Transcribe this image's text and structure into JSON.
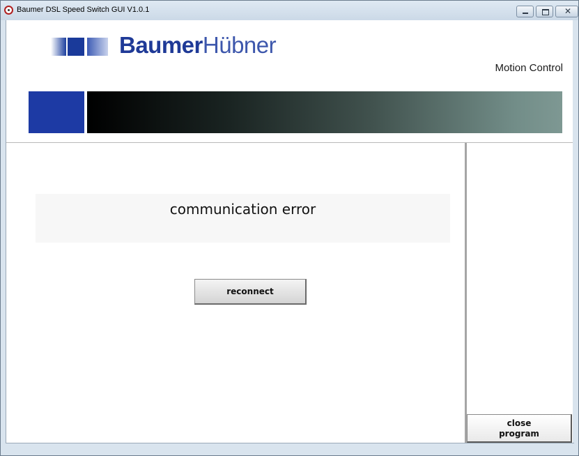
{
  "window": {
    "title": "Baumer DSL Speed Switch GUI V1.0.1",
    "controls": {
      "minimize": "minimize-icon",
      "maximize": "maximize-icon",
      "close": "close-icon",
      "close_glyph": "✕"
    }
  },
  "header": {
    "logo": {
      "brand_bold": "Baumer",
      "brand_light": "Hübner",
      "brand_color": "#1f3a97"
    },
    "tagline": "Motion Control",
    "accent_block_color": "#1d3aa4"
  },
  "main": {
    "status_message": "communication error",
    "reconnect_label": "reconnect"
  },
  "side": {
    "close_program_line1": "close",
    "close_program_line2": "program"
  }
}
